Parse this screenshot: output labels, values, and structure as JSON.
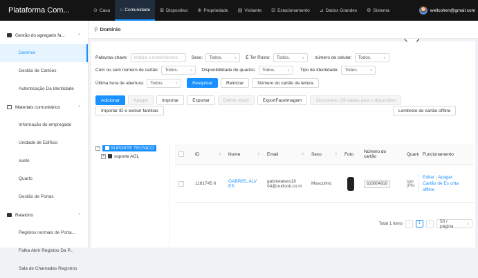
{
  "app": {
    "brand": "Plataforma Com..."
  },
  "topnav": [
    {
      "icon": "home-icon",
      "glyph": "⊙",
      "label": "Casa"
    },
    {
      "icon": "community-icon",
      "glyph": "⌂",
      "label": "Comunidade",
      "active": true
    },
    {
      "icon": "device-icon",
      "glyph": "⊞",
      "label": "Dispositivo"
    },
    {
      "icon": "property-icon",
      "glyph": "⊕",
      "label": "Propriedade"
    },
    {
      "icon": "visitor-icon",
      "glyph": "▤",
      "label": "Visitante"
    },
    {
      "icon": "parking-icon",
      "glyph": "⊟",
      "label": "Estacionamento"
    },
    {
      "icon": "chart-icon",
      "glyph": "⊿",
      "label": "Dados Grandes"
    },
    {
      "icon": "gear-icon",
      "glyph": "⚙",
      "label": "Sistema"
    }
  ],
  "user": {
    "email": "wellcohen@gmail.com"
  },
  "sidebar": {
    "groups": [
      {
        "label": "Gestão do agregado fa...",
        "items": [
          "Domínio",
          "Gestão de Cartões",
          "Autenticação Da Identidade"
        ]
      },
      {
        "label": "Materiais comunitários",
        "items": [
          "Informação do empregado",
          "Unidade de Edifício",
          "suelo",
          "Quarto",
          "Gestão de Portas"
        ]
      },
      {
        "label": "Relatório",
        "items": [
          "Registos normais de Porta...",
          "Falha Abrir Registos Da P...",
          "Sala de Chamadas Registros"
        ]
      }
    ]
  },
  "page": {
    "title": "Domínio"
  },
  "filters": {
    "keyword_label": "Palavras-chave:",
    "keyword_placeholder": "Indique o nome/número",
    "sex_label": "Sexo:",
    "sex_value": "Todos.",
    "face_label": "É Ter Rosto:",
    "face_value": "Todos.",
    "phone_label": "número de celular:",
    "phone_value": "Todos.",
    "card_label": "Com ou sem número de cartão:",
    "card_value": "Todos.",
    "rooms_label": "Disponibilidade de quartos:",
    "rooms_value": "Todos.",
    "idtype_label": "Tipo de Identidade:",
    "idtype_value": "Todos.",
    "opening_label": "Última hora de abertura:",
    "opening_value": "Todos.",
    "search_btn": "Pesquisar",
    "reset_btn": "Reiniciar",
    "card_read_btn": "Número do cartão de leitura"
  },
  "toolbar": {
    "add": "Adicionar",
    "delete": "Apagar",
    "import": "Importar",
    "export": "Exportar",
    "label": "Definir rótulo",
    "export_face": "ExportFaceImagem",
    "sync": "Sincronizar OS dados para o dispositivo",
    "import_delete": "Importar ID e excluir famílias",
    "offline": "Lembrete de cartão offline"
  },
  "tree": {
    "root": "SUPORTE TECNICO",
    "child": "suporte AGL"
  },
  "table": {
    "headers": [
      "ID",
      "Nome",
      "Email",
      "Sexo",
      "Foto",
      "Número do cartão",
      "Quarto",
      "Funcionamento"
    ],
    "rows": [
      {
        "id": "1181745 6",
        "name": "GABRIEL ALV ES",
        "email": "gabrielalves18 04@outlook.co m",
        "sex": "Masculino",
        "card": "619804918",
        "room": "sup (Pro",
        "actions": [
          "Editar",
          "Apagar",
          "Cartão de Es crita offline"
        ]
      }
    ]
  },
  "pagination": {
    "total": "Total 1 itens",
    "page": "1",
    "size": "50 / página"
  }
}
